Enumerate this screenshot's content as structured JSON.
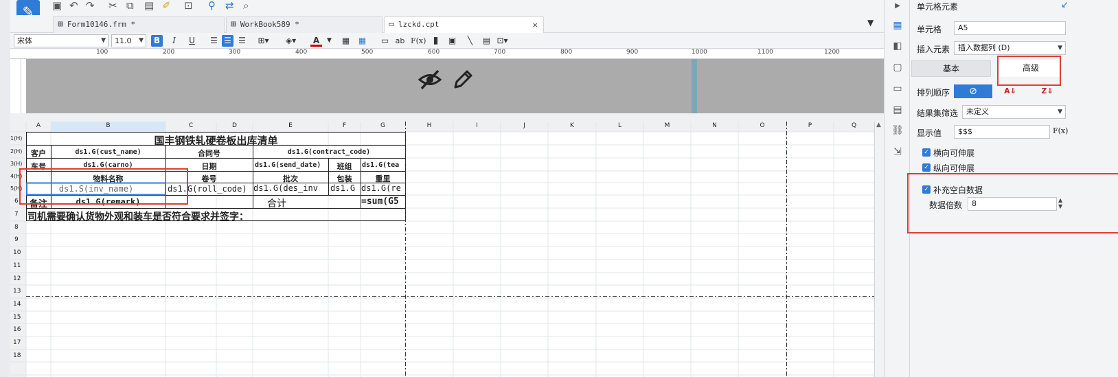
{
  "tabs": [
    {
      "label": "Form10146.frm *",
      "active": false
    },
    {
      "label": "WorkBook589 *",
      "active": false
    },
    {
      "label": "lzckd.cpt",
      "active": true
    }
  ],
  "format_toolbar": {
    "font_name": "宋体",
    "font_size": "11.0",
    "bold": "B",
    "italic": "I",
    "underline": "U",
    "formula": "F(x)",
    "ab": "ab"
  },
  "ruler": {
    "labels": [
      "100",
      "200",
      "300",
      "400",
      "500",
      "600",
      "700",
      "800",
      "900",
      "1000",
      "1100",
      "1200"
    ]
  },
  "sheet": {
    "columns": [
      "A",
      "B",
      "C",
      "D",
      "E",
      "F",
      "G",
      "H",
      "I",
      "J",
      "K",
      "L",
      "M",
      "N",
      "O",
      "P",
      "Q"
    ],
    "rows": [
      "1(H)",
      "2(H)",
      "3(H)",
      "4(H)",
      "5(H)",
      "6",
      "7",
      "8",
      "9",
      "10",
      "11",
      "12",
      "13",
      "14",
      "15",
      "16",
      "17",
      "18"
    ],
    "cells": {
      "title": "国丰钢铁轧硬卷板出库清单",
      "r2a": "客户",
      "r2b": "ds1.G(cust_name)",
      "r2c": "合同号",
      "r2e": "ds1.G(contract_code)",
      "r3a": "车号",
      "r3b": "ds1.G(carno)",
      "r3c": "日期",
      "r3e": "ds1.G(send_date)",
      "r3f": "班组",
      "r3g": "ds1.G(tea",
      "r4b": "物料名称",
      "r4c": "卷号",
      "r4e": "批次",
      "r4f": "包装",
      "r4g": "重里",
      "r5b": "ds1.S(inv_name)",
      "r5c": "ds1.G(roll_code)",
      "r5e": "ds1.G(des_inv",
      "r5f": "ds1.G",
      "r5g": "ds1.G(re",
      "r6a": "备注",
      "r6b": "ds1.G(remark)",
      "r6e": "合计",
      "r6g": "=sum(G5",
      "r7": "司机需要确认货物外观和装车是否符合要求并签字："
    }
  },
  "panel": {
    "title": "单元格元素",
    "cell_label": "单元格",
    "cell_value": "A5",
    "insert_label": "插入元素",
    "insert_value": "插入数据列 (D)",
    "tab_basic": "基本",
    "tab_advanced": "高级",
    "sort_label": "排列顺序",
    "filter_label": "结果集筛选",
    "filter_value": "未定义",
    "display_label": "显示值",
    "display_value": "$$$",
    "display_fx": "F(x)",
    "h_expand": "横向可伸展",
    "v_expand": "纵向可伸展",
    "fill_blank": "补充空白数据",
    "multiple_label": "数据倍数",
    "multiple_value": "8"
  },
  "colors": {
    "accent": "#2f7bd6",
    "highlight": "#e53935",
    "header_band": "#ababab"
  }
}
